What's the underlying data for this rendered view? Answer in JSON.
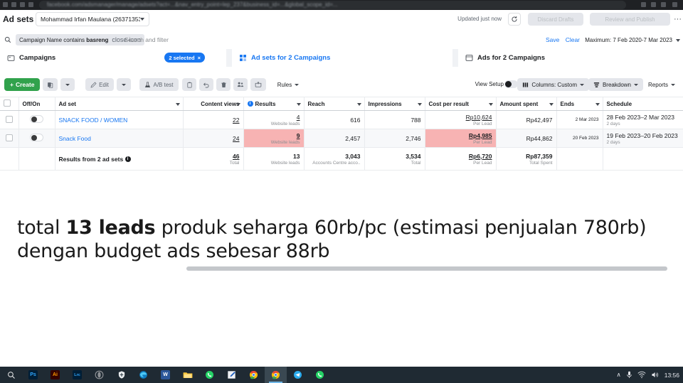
{
  "browser": {
    "url_blurred": "facebook.com/adsmanager/manage/adsets?act=...&nav_entry_point=lep_237&business_id=...&global_scope_id=..."
  },
  "topbar": {
    "title": "Ad sets",
    "account_selector": "Mohammad Irfan Maulana (26371353..",
    "updated_status": "Updated just now",
    "refresh_icon": "refresh-icon",
    "discard_label": "Discard Drafts",
    "review_label": "Review and Publish",
    "more_label": "···"
  },
  "filterbar": {
    "search_icon": "search-icon",
    "chip_prefix": "Campaign Name contains ",
    "chip_value": "basreng",
    "chip_remove_icon": "close-icon",
    "search_placeholder": "Search and filter",
    "save_label": "Save",
    "clear_label": "Clear",
    "date_range": "Maximum: 7 Feb 2020-7 Mar 2023"
  },
  "tabs": [
    {
      "label": "Campaigns",
      "icon": "folder-icon",
      "badge": "2 selected",
      "badge_close": "×",
      "active": false
    },
    {
      "label": "Ad sets for 2 Campaigns",
      "icon": "grid-icon",
      "active": true
    },
    {
      "label": "Ads for 2 Campaigns",
      "icon": "window-icon",
      "active": false
    }
  ],
  "toolbar": {
    "create_label": "Create",
    "create_icon": "plus-icon",
    "duplicate_icon": "duplicate-icon",
    "edit_label": "Edit",
    "edit_icon": "pencil-icon",
    "abtest_label": "A/B test",
    "abtest_icon": "flask-icon",
    "copy_icon": "clipboard-icon",
    "undo_icon": "undo-icon",
    "delete_icon": "trash-icon",
    "audience_icon": "people-icon",
    "export_icon": "export-icon",
    "rules_label": "Rules",
    "view_setup_label": "View Setup",
    "columns_label": "Columns: Custom",
    "columns_icon": "columns-icon",
    "breakdown_label": "Breakdown",
    "breakdown_icon": "breakdown-icon",
    "reports_label": "Reports"
  },
  "table": {
    "columns": [
      {
        "key": "check",
        "label": ""
      },
      {
        "key": "offon",
        "label": "Off/On"
      },
      {
        "key": "adset",
        "label": "Ad set"
      },
      {
        "key": "content",
        "label": "Content views"
      },
      {
        "key": "results",
        "label": "Results",
        "has_info": true
      },
      {
        "key": "reach",
        "label": "Reach"
      },
      {
        "key": "impr",
        "label": "Impressions"
      },
      {
        "key": "cpr",
        "label": "Cost per result"
      },
      {
        "key": "spent",
        "label": "Amount spent"
      },
      {
        "key": "ends",
        "label": "Ends"
      },
      {
        "key": "sched",
        "label": "Schedule"
      }
    ],
    "rows": [
      {
        "name": "SNACK FOOD / WOMEN",
        "content_views": "22",
        "results": "4",
        "results_sub": "Website leads",
        "results_highlight": false,
        "reach": "616",
        "impressions": "788",
        "cost_per_result": "Rp10,624",
        "cost_sub": "Per Lead",
        "cost_highlight": false,
        "amount_spent": "Rp42,497",
        "ends": "2 Mar 2023",
        "schedule": "28 Feb 2023–2 Mar 2023",
        "schedule_sub": "2 days"
      },
      {
        "name": "Snack Food",
        "content_views": "24",
        "results": "9",
        "results_sub": "Website leads",
        "results_highlight": true,
        "reach": "2,457",
        "impressions": "2,746",
        "cost_per_result": "Rp4,985",
        "cost_sub": "Per Lead",
        "cost_highlight": true,
        "amount_spent": "Rp44,862",
        "ends": "20 Feb 2023",
        "schedule": "19 Feb 2023–20 Feb 2023",
        "schedule_sub": "2 days"
      }
    ],
    "total_row": {
      "label": "Results from 2 ad sets",
      "content_views": "46",
      "content_sub": "Total",
      "results": "13",
      "results_sub": "Website leads",
      "reach": "3,043",
      "reach_sub": "Accounts Centre acco..",
      "impressions": "3,534",
      "impressions_sub": "Total",
      "cost_per_result": "Rp6,720",
      "cost_sub": "Per Lead",
      "amount_spent": "Rp87,359",
      "spent_sub": "Total Spent"
    }
  },
  "caption": {
    "part1": "total ",
    "highlight": "13 leads",
    "part2": " produk seharga 60rb/pc (estimasi penjualan 780rb) dengan budget ads sebesar 88rb"
  },
  "taskbar": {
    "items": [
      {
        "name": "search-icon",
        "glyph": "⌕",
        "color": "#ffffff",
        "shape": "text"
      },
      {
        "name": "photoshop-icon",
        "glyph": "Ps",
        "color": "#31a8ff",
        "bg": "#001e36",
        "shape": "sq"
      },
      {
        "name": "illustrator-icon",
        "glyph": "Ai",
        "color": "#ff9a00",
        "bg": "#330000",
        "shape": "sq"
      },
      {
        "name": "lightroom-icon",
        "glyph": "Lrc",
        "color": "#31a8ff",
        "bg": "#001e36",
        "shape": "sq"
      },
      {
        "name": "opera-gx-icon",
        "glyph": "",
        "color": "#8f9296",
        "shape": "circ"
      },
      {
        "name": "shield-icon",
        "glyph": "",
        "color": "#e9ebee",
        "shape": "shield"
      },
      {
        "name": "edge-icon",
        "glyph": "",
        "color": "#0e7cc0",
        "shape": "circ"
      },
      {
        "name": "word-icon",
        "glyph": "W",
        "color": "#ffffff",
        "bg": "#2b579a",
        "shape": "sq"
      },
      {
        "name": "file-explorer-icon",
        "glyph": "",
        "color": "#ffc83d",
        "shape": "folder"
      },
      {
        "name": "whatsapp-icon",
        "glyph": "",
        "color": "#25d366",
        "shape": "circ"
      },
      {
        "name": "notepad-icon",
        "glyph": "",
        "color": "#f0f2f5",
        "shape": "note"
      },
      {
        "name": "chrome-icon",
        "glyph": "",
        "color": "#ea4335",
        "shape": "chrome"
      },
      {
        "name": "chrome-active-icon",
        "glyph": "",
        "color": "#ea4335",
        "shape": "chrome",
        "active": true
      },
      {
        "name": "telegram-icon",
        "glyph": "",
        "color": "#2aabee",
        "shape": "circ"
      },
      {
        "name": "whatsapp-2-icon",
        "glyph": "",
        "color": "#25d366",
        "shape": "circ"
      }
    ],
    "tray": {
      "chevron": "∧",
      "mic_icon": "microphone-icon",
      "network_icon": "wifi-icon",
      "volume_icon": "volume-icon",
      "clock": "13:56"
    }
  }
}
